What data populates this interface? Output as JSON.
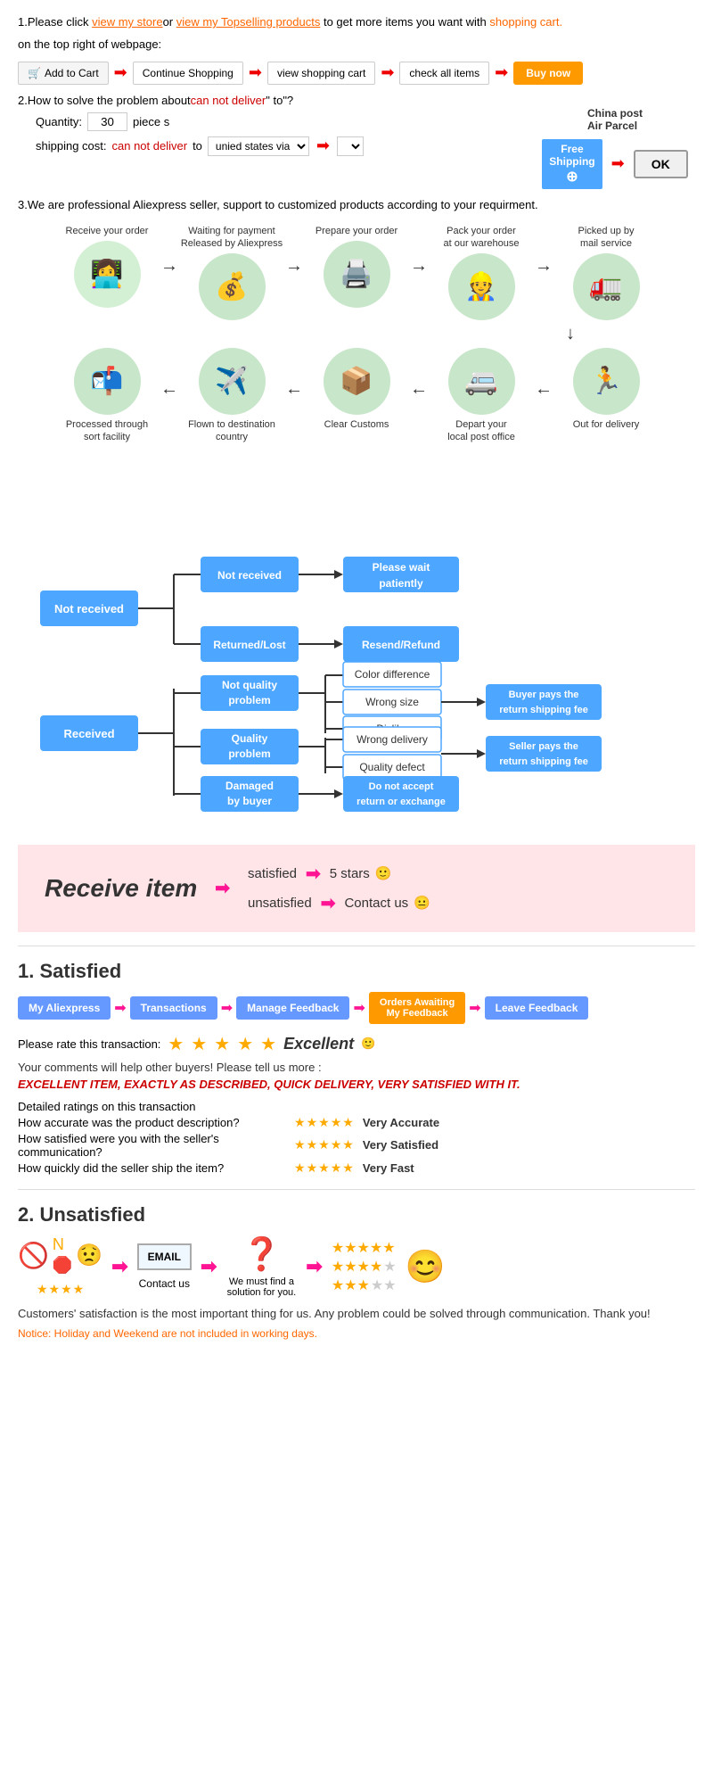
{
  "section1": {
    "text1": "1.Please click ",
    "link1": "view my store",
    "text2": "or ",
    "link2": "view my Topselling products",
    "text3": " to get more items you want with",
    "shopping_cart": "shopping cart.",
    "text4": "on the top right of webpage:",
    "btn_add": "Add to Cart",
    "btn_continue": "Continue Shopping",
    "btn_view": "view shopping cart",
    "btn_check": "check all items",
    "btn_buy": "Buy now"
  },
  "section2": {
    "text1": "2.How to solve the problem about",
    "red1": "can not deliver",
    "text2": " to",
    "question": "\"?",
    "qty_label": "Quantity:",
    "qty_value": "30",
    "qty_unit": "piece s",
    "ship_label": "shipping cost:",
    "ship_red": "can not deliver",
    "ship_text": " to ",
    "ship_select": "unied states via",
    "china_post_line1": "China post",
    "china_post_line2": "Air Parcel",
    "free_shipping": "Free\nShipping",
    "ok_btn": "OK"
  },
  "section3": {
    "text": "3.We are professional Aliexpress seller, support to customized products according to your requirment."
  },
  "process": {
    "top_items": [
      {
        "label": "Receive your order",
        "icon": "👩‍💻"
      },
      {
        "label": "Waiting for payment\nReleased by Aliexpress",
        "icon": "💰"
      },
      {
        "label": "Prepare your order",
        "icon": "🖨️"
      },
      {
        "label": "Pack your order\nat our warehouse",
        "icon": "👷"
      },
      {
        "label": "Picked up by\nmail service",
        "icon": "🚛"
      }
    ],
    "bottom_items": [
      {
        "label": "Out for delivery",
        "icon": "🏃"
      },
      {
        "label": "Depart your\nlocal post office",
        "icon": "🚐"
      },
      {
        "label": "Clear Customs",
        "icon": "📦"
      },
      {
        "label": "Flown to destination\ncountry",
        "icon": "✈️"
      },
      {
        "label": "Processed through\nsort facility",
        "icon": "📬"
      }
    ]
  },
  "flowchart": {
    "not_received": "Not received",
    "not_received_branch1": "Not received",
    "not_received_branch2": "Returned/Lost",
    "outcome1": "Please wait\npatiently",
    "outcome2": "Resend/Refund",
    "received": "Received",
    "not_quality": "Not quality\nproblem",
    "quality": "Quality\nproblem",
    "damaged": "Damaged\nby buyer",
    "nq_items": [
      "Color difference",
      "Wrong size",
      "Dislike"
    ],
    "q_items": [
      "Wrong delivery",
      "Quality defect"
    ],
    "nq_outcome": "Buyer pays the\nreturn shipping fee",
    "q_outcome": "Seller pays the\nreturn shipping fee",
    "d_outcome": "Do not accept\nreturn or exchange"
  },
  "receive_section": {
    "title": "Receive item",
    "satisfied": "satisfied",
    "unsatisfied": "unsatisfied",
    "result1": "5 stars",
    "result2": "Contact us",
    "emoji1": "🙂",
    "emoji2": "😐"
  },
  "satisfied": {
    "title": "1. Satisfied",
    "steps": [
      "My Aliexpress",
      "Transactions",
      "Manage Feedback",
      "Orders Awaiting\nMy Feedback",
      "Leave Feedback"
    ],
    "rate_label": "Please rate this transaction:",
    "excellent": "Excellent",
    "emoji": "🙂",
    "comments": "Your comments will help other buyers! Please tell us more :",
    "review": "EXCELLENT ITEM, EXACTLY AS DESCRIBED, QUICK DELIVERY, VERY SATISFIED WITH IT.",
    "detailed_title": "Detailed ratings on this transaction",
    "ratings": [
      {
        "label": "How accurate was the product description?",
        "result": "Very Accurate"
      },
      {
        "label": "How satisfied were you with the seller's communication?",
        "result": "Very Satisfied"
      },
      {
        "label": "How quickly did the seller ship the item?",
        "result": "Very Fast"
      }
    ]
  },
  "unsatisfied": {
    "title": "2. Unsatisfied",
    "no_icon": "🚫",
    "n_icon": "N",
    "stop_icon": "🛑",
    "emoji_sad": "😟",
    "email_label": "EMAIL",
    "contact_label": "Contact us",
    "question_label": "We must find\na solution for\nyou.",
    "star_rows": [
      "★★★★★",
      "★★★★☆",
      "★★★☆☆"
    ],
    "emoji_happy": "😊",
    "footer_text": "Customers' satisfaction is the most important thing for us. Any problem could be solved through communication. Thank you!",
    "notice": "Notice: Holiday and Weekend are not included in working days."
  }
}
